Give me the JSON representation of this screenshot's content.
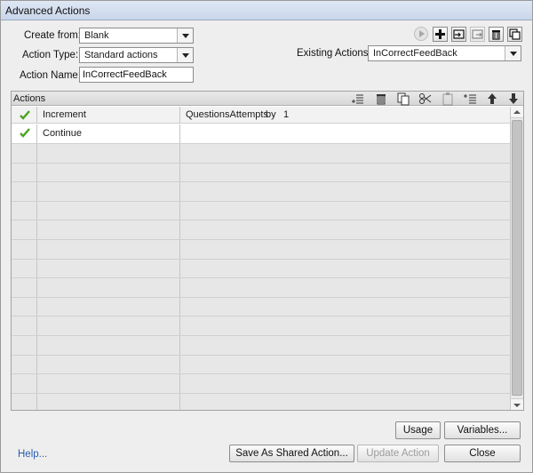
{
  "window": {
    "title": "Advanced Actions"
  },
  "form": {
    "create_from_label": "Create from:",
    "create_from_value": "Blank",
    "action_type_label": "Action Type:",
    "action_type_value": "Standard actions",
    "action_name_label": "Action Name:",
    "action_name_value": "InCorrectFeedBack",
    "existing_actions_label": "Existing Actions:",
    "existing_actions_value": "InCorrectFeedBack"
  },
  "toolbar_icons": [
    "preview-icon",
    "add-icon",
    "import-icon",
    "export-icon",
    "delete-icon",
    "duplicate-icon"
  ],
  "actions_panel": {
    "title": "Actions",
    "toolbar_icons": [
      "insert-row-icon",
      "delete-row-icon",
      "copy-icon",
      "cut-icon",
      "paste-icon",
      "insert-above-icon",
      "move-up-icon",
      "move-down-icon"
    ],
    "header": {
      "command": "Increment",
      "target": "QuestionsAttempts",
      "op": "by",
      "amount": "1"
    },
    "rows": [
      {
        "command": "Continue",
        "target": "",
        "checked": true
      }
    ],
    "empty_rows": 14
  },
  "buttons": {
    "usage": "Usage",
    "variables": "Variables...",
    "save_shared": "Save As Shared Action...",
    "update": "Update Action",
    "close": "Close"
  },
  "help_link": "Help...",
  "colors": {
    "check": "#4aa31f",
    "title_bar": "#c9d6ea",
    "link": "#2a5db0"
  }
}
